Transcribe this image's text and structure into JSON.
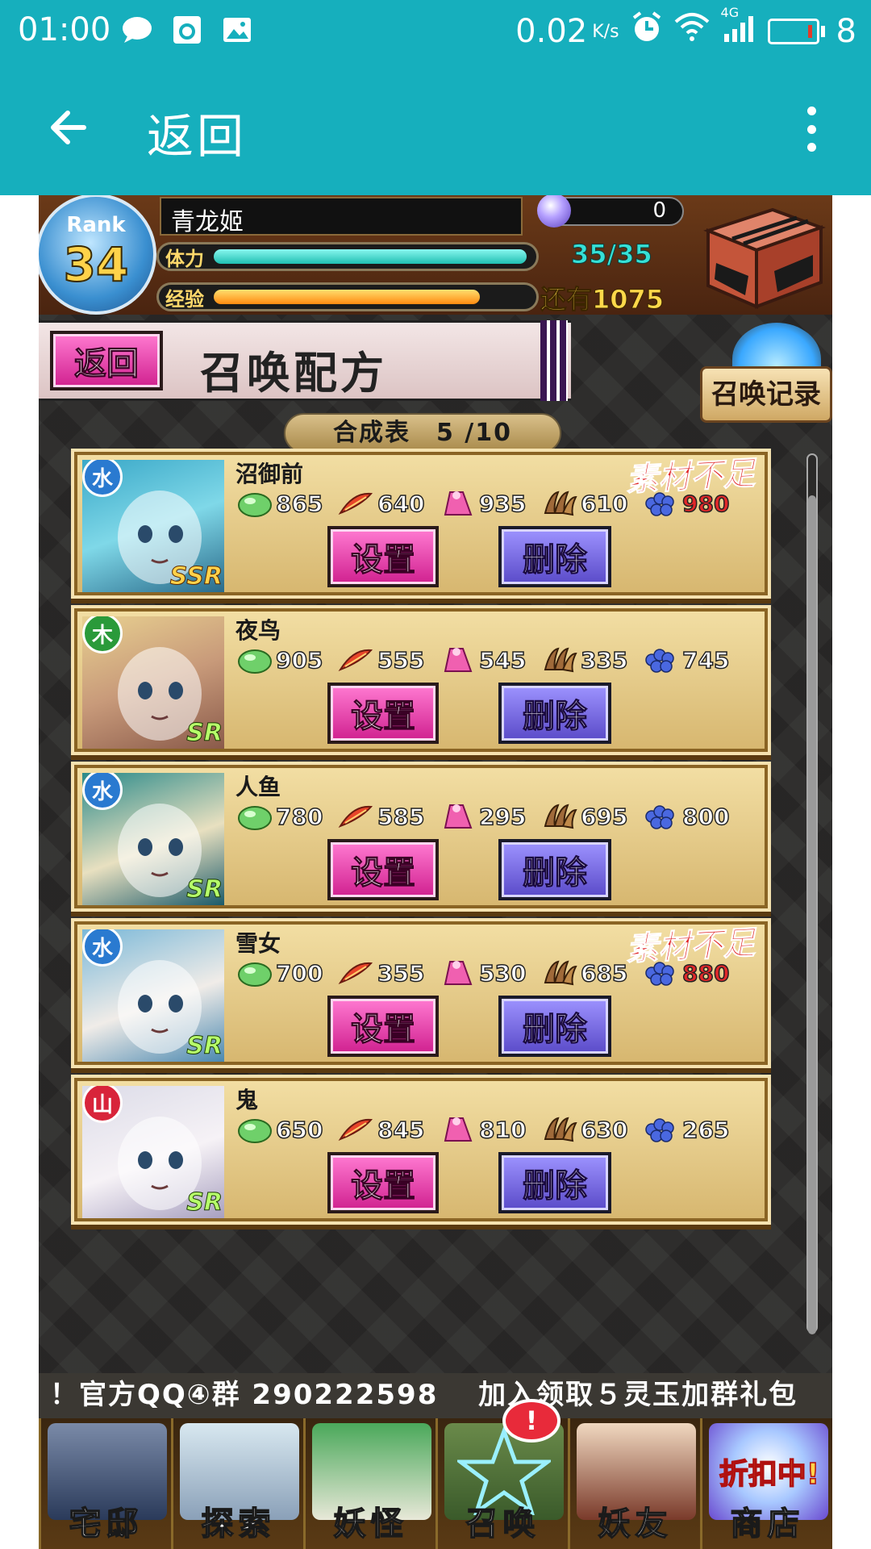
{
  "status_bar": {
    "time": "01:00",
    "net_speed": "0.02",
    "net_unit": "K/s",
    "signal_label": "4G",
    "battery_level": "8",
    "icons": [
      "message-icon",
      "app-icon",
      "image-icon",
      "alarm-icon",
      "wifi-icon",
      "signal-icon",
      "battery-icon"
    ]
  },
  "app_bar": {
    "back_icon": "arrow-left-icon",
    "title": "返回",
    "menu_icon": "more-vert-icon"
  },
  "player": {
    "rank_label": "Rank",
    "rank": "34",
    "name": "青龙姬",
    "orbs": "0",
    "stamina_label": "体力",
    "stamina_value": "35/35",
    "stamina_fraction": 1.0,
    "exp_label": "经验",
    "exp_remaining": "还有1075",
    "exp_fraction": 0.85
  },
  "page": {
    "back_button": "返回",
    "title": "召唤配方",
    "log_button": "召唤记录",
    "recipe_count": "合成表　5 /10"
  },
  "buttons": {
    "set": "设置",
    "delete": "删除"
  },
  "recipes": [
    {
      "name": "沼御前",
      "rarity": "SSR",
      "attribute": "water",
      "attr_glyph": "水",
      "warning": "素材不足",
      "materials": [
        "865",
        "640",
        "935",
        "610",
        "980"
      ],
      "short_index": 4
    },
    {
      "name": "夜鸟",
      "rarity": "SR",
      "attribute": "wood",
      "attr_glyph": "木",
      "warning": "",
      "materials": [
        "905",
        "555",
        "545",
        "335",
        "745"
      ],
      "short_index": -1
    },
    {
      "name": "人鱼",
      "rarity": "SR",
      "attribute": "water",
      "attr_glyph": "水",
      "warning": "",
      "materials": [
        "780",
        "585",
        "295",
        "695",
        "800"
      ],
      "short_index": -1
    },
    {
      "name": "雪女",
      "rarity": "SR",
      "attribute": "water",
      "attr_glyph": "水",
      "warning": "素材不足",
      "materials": [
        "700",
        "355",
        "530",
        "685",
        "880"
      ],
      "short_index": 4
    },
    {
      "name": "鬼",
      "rarity": "SR",
      "attribute": "mountain",
      "attr_glyph": "山",
      "warning": "",
      "materials": [
        "650",
        "845",
        "810",
        "630",
        "265"
      ],
      "short_index": -1
    }
  ],
  "material_icons": [
    "green-orb-icon",
    "red-feather-icon",
    "pink-cloth-icon",
    "claw-icon",
    "blue-berry-icon"
  ],
  "ticker": "！官方QQ④群 290222598　 加入领取５灵玉加群礼包",
  "nav": [
    {
      "label": "宅邸",
      "icon": "mansion-icon"
    },
    {
      "label": "探索",
      "icon": "magnifier-icon"
    },
    {
      "label": "妖怪",
      "icon": "scroll-icon"
    },
    {
      "label": "召唤",
      "icon": "pentagram-icon",
      "badge": "!"
    },
    {
      "label": "妖友",
      "icon": "catgirl-icon"
    },
    {
      "label": "商店",
      "icon": "shop-orb-icon",
      "sale": "折扣中!"
    }
  ],
  "colors": {
    "app_bar": "#16afbd",
    "stamina": "#36e0d6",
    "exp": "#ffb020",
    "warning": "#e0282a"
  }
}
